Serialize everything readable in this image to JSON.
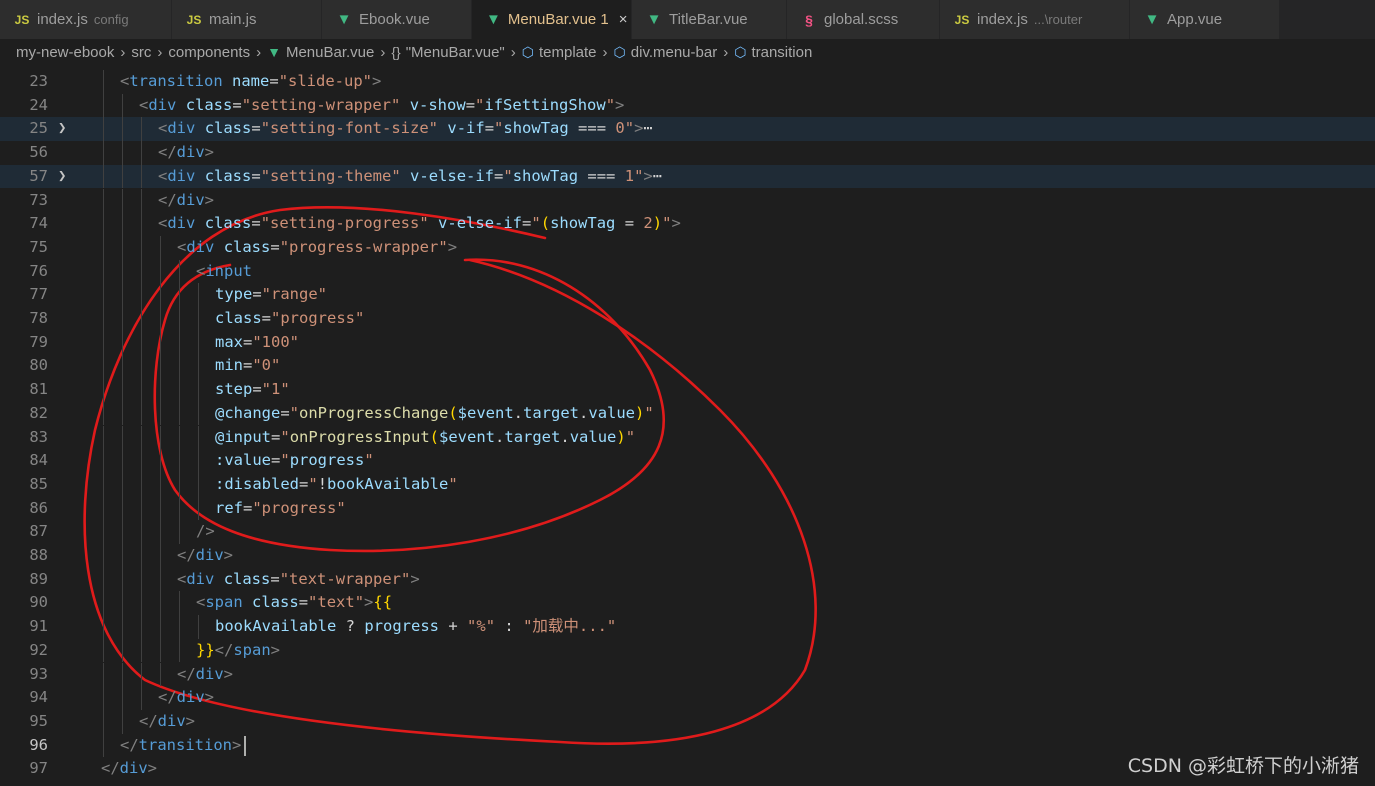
{
  "tabs": [
    {
      "icon": "JS",
      "kind": "js",
      "label": "index.js",
      "sub": "config",
      "active": false,
      "width": 172
    },
    {
      "icon": "JS",
      "kind": "js",
      "label": "main.js",
      "sub": "",
      "active": false,
      "width": 150
    },
    {
      "icon": "V",
      "kind": "vue",
      "label": "Ebook.vue",
      "sub": "",
      "active": false,
      "width": 150
    },
    {
      "icon": "V",
      "kind": "vue",
      "label": "MenuBar.vue 1",
      "sub": "",
      "active": true,
      "close": "×",
      "width": 160
    },
    {
      "icon": "V",
      "kind": "vue",
      "label": "TitleBar.vue",
      "sub": "",
      "active": false,
      "width": 155
    },
    {
      "icon": "S",
      "kind": "scss",
      "label": "global.scss",
      "sub": "",
      "active": false,
      "width": 153
    },
    {
      "icon": "JS",
      "kind": "js",
      "label": "index.js",
      "sub": "...\\router",
      "active": false,
      "width": 190
    },
    {
      "icon": "V",
      "kind": "vue",
      "label": "App.vue",
      "sub": "",
      "active": false,
      "width": 150
    }
  ],
  "breadcrumb": [
    {
      "icon": "",
      "label": "my-new-ebook"
    },
    {
      "icon": "",
      "label": "src"
    },
    {
      "icon": "",
      "label": "components"
    },
    {
      "icon": "vue",
      "label": "MenuBar.vue"
    },
    {
      "icon": "braces",
      "label": "\"MenuBar.vue\""
    },
    {
      "icon": "cube",
      "label": "template"
    },
    {
      "icon": "cube",
      "label": "div.menu-bar"
    },
    {
      "icon": "cube",
      "label": "transition"
    }
  ],
  "code_lines": [
    {
      "n": "23",
      "indent": 2,
      "html": "<span class='t'>&lt;</span><span class='tg'>transition</span> <span class='at'>name</span><span class='eq'>=</span><span class='st'>\"slide-up\"</span><span class='t'>&gt;</span>"
    },
    {
      "n": "24",
      "indent": 3,
      "html": "<span class='t'>&lt;</span><span class='tg'>div</span> <span class='at'>class</span><span class='eq'>=</span><span class='st'>\"setting-wrapper\"</span> <span class='at'>v-show</span><span class='eq'>=</span><span class='st'>\"</span><span class='vr'>ifSettingShow</span><span class='st'>\"</span><span class='t'>&gt;</span>"
    },
    {
      "n": "25",
      "indent": 4,
      "fold": true,
      "hl": true,
      "html": "<span class='t'>&lt;</span><span class='tg'>div</span> <span class='at'>class</span><span class='eq'>=</span><span class='st'>\"setting-font-size\"</span> <span class='at'>v-if</span><span class='eq'>=</span><span class='st'>\"</span><span class='vr'>showTag</span> <span class='pl'>===</span> <span class='st'>0\"</span><span class='t'>&gt;</span><span class='pl'>⋯</span>"
    },
    {
      "n": "56",
      "indent": 4,
      "html": "<span class='t'>&lt;/</span><span class='tg'>div</span><span class='t'>&gt;</span>"
    },
    {
      "n": "57",
      "indent": 4,
      "fold": true,
      "hl": true,
      "html": "<span class='t'>&lt;</span><span class='tg'>div</span> <span class='at'>class</span><span class='eq'>=</span><span class='st'>\"setting-theme\"</span> <span class='at'>v-else-if</span><span class='eq'>=</span><span class='st'>\"</span><span class='vr'>showTag</span> <span class='pl'>===</span> <span class='st'>1\"</span><span class='t'>&gt;</span><span class='pl'>⋯</span>"
    },
    {
      "n": "73",
      "indent": 4,
      "html": "<span class='t'>&lt;/</span><span class='tg'>div</span><span class='t'>&gt;</span>"
    },
    {
      "n": "74",
      "indent": 4,
      "html": "<span class='t'>&lt;</span><span class='tg'>div</span> <span class='at'>class</span><span class='eq'>=</span><span class='st'>\"setting-progress\"</span> <span class='at'>v-else-if</span><span class='eq'>=</span><span class='st'>\"</span><span class='br'>(</span><span class='vr'>showTag</span> <span class='pl'>=</span> <span class='st'>2</span><span class='br'>)</span><span class='st'>\"</span><span class='t'>&gt;</span>"
    },
    {
      "n": "75",
      "indent": 5,
      "html": "<span class='t'>&lt;</span><span class='tg'>div</span> <span class='at'>class</span><span class='eq'>=</span><span class='st'>\"progress-wrapper\"</span><span class='t'>&gt;</span>"
    },
    {
      "n": "76",
      "indent": 6,
      "html": "<span class='t'>&lt;</span><span class='tg'>input</span>"
    },
    {
      "n": "77",
      "indent": 7,
      "html": "<span class='at'>type</span><span class='eq'>=</span><span class='st'>\"range\"</span>"
    },
    {
      "n": "78",
      "indent": 7,
      "html": "<span class='at'>class</span><span class='eq'>=</span><span class='st'>\"progress\"</span>"
    },
    {
      "n": "79",
      "indent": 7,
      "html": "<span class='at'>max</span><span class='eq'>=</span><span class='st'>\"100\"</span>"
    },
    {
      "n": "80",
      "indent": 7,
      "html": "<span class='at'>min</span><span class='eq'>=</span><span class='st'>\"0\"</span>"
    },
    {
      "n": "81",
      "indent": 7,
      "html": "<span class='at'>step</span><span class='eq'>=</span><span class='st'>\"1\"</span>"
    },
    {
      "n": "82",
      "indent": 7,
      "html": "<span class='at'>@change</span><span class='eq'>=</span><span class='st'>\"</span><span class='fn'>onProgressChange</span><span class='br'>(</span><span class='vr'>$event</span><span class='pl'>.</span><span class='vr'>target</span><span class='pl'>.</span><span class='vr'>value</span><span class='br'>)</span><span class='st'>\"</span>"
    },
    {
      "n": "83",
      "indent": 7,
      "html": "<span class='at'>@input</span><span class='eq'>=</span><span class='st'>\"</span><span class='fn'>onProgressInput</span><span class='br'>(</span><span class='vr'>$event</span><span class='pl'>.</span><span class='vr'>target</span><span class='pl'>.</span><span class='vr'>value</span><span class='br'>)</span><span class='st'>\"</span>"
    },
    {
      "n": "84",
      "indent": 7,
      "html": "<span class='at'>:value</span><span class='eq'>=</span><span class='st'>\"</span><span class='vr'>progress</span><span class='st'>\"</span>"
    },
    {
      "n": "85",
      "indent": 7,
      "html": "<span class='at'>:disabled</span><span class='eq'>=</span><span class='st'>\"</span><span class='pl'>!</span><span class='vr'>bookAvailable</span><span class='st'>\"</span>"
    },
    {
      "n": "86",
      "indent": 7,
      "html": "<span class='at'>ref</span><span class='eq'>=</span><span class='st'>\"progress\"</span>"
    },
    {
      "n": "87",
      "indent": 6,
      "html": "<span class='t'>/&gt;</span>"
    },
    {
      "n": "88",
      "indent": 5,
      "html": "<span class='t'>&lt;/</span><span class='tg'>div</span><span class='t'>&gt;</span>"
    },
    {
      "n": "89",
      "indent": 5,
      "html": "<span class='t'>&lt;</span><span class='tg'>div</span> <span class='at'>class</span><span class='eq'>=</span><span class='st'>\"text-wrapper\"</span><span class='t'>&gt;</span>"
    },
    {
      "n": "90",
      "indent": 6,
      "html": "<span class='t'>&lt;</span><span class='tg'>span</span> <span class='at'>class</span><span class='eq'>=</span><span class='st'>\"text\"</span><span class='t'>&gt;</span><span class='br'>{{</span>"
    },
    {
      "n": "91",
      "indent": 7,
      "html": "<span class='vr'>bookAvailable</span> <span class='pl'>?</span> <span class='vr'>progress</span> <span class='pl'>+</span> <span class='st'>\"%\"</span> <span class='pl'>:</span> <span class='st'>\"加载中...\"</span>"
    },
    {
      "n": "92",
      "indent": 6,
      "html": "<span class='br'>}}</span><span class='t'>&lt;/</span><span class='tg'>span</span><span class='t'>&gt;</span>"
    },
    {
      "n": "93",
      "indent": 5,
      "html": "<span class='t'>&lt;/</span><span class='tg'>div</span><span class='t'>&gt;</span>"
    },
    {
      "n": "94",
      "indent": 4,
      "html": "<span class='t'>&lt;/</span><span class='tg'>div</span><span class='t'>&gt;</span>"
    },
    {
      "n": "95",
      "indent": 3,
      "html": "<span class='t'>&lt;/</span><span class='tg'>div</span><span class='t'>&gt;</span>"
    },
    {
      "n": "96",
      "indent": 2,
      "current": true,
      "html": "<span class='t'>&lt;/</span><span class='tg'>transition</span><span class='t'>&gt;</span>"
    },
    {
      "n": "97",
      "indent": 1,
      "html": "<span class='t'>&lt;/</span><span class='tg'>div</span><span class='t'>&gt;</span>"
    }
  ],
  "annotation": {
    "color": "#e01b1b"
  },
  "watermark": "CSDN @彩虹桥下的小淅猪",
  "colors": {
    "tag": "#569cd6",
    "attr": "#9cdcfe",
    "string": "#ce9178",
    "bracket": "#ffd700",
    "function": "#dcdcaa",
    "active_tab_text": "#e2c08d"
  }
}
